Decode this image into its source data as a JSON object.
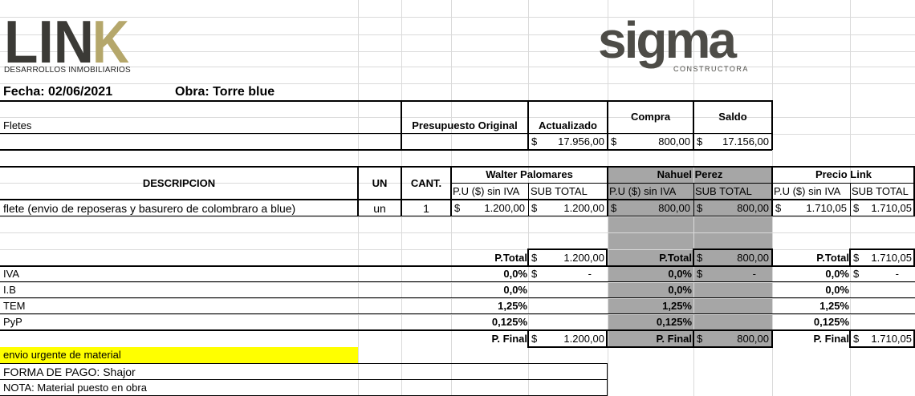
{
  "logos": {
    "link": {
      "word": "LINK",
      "subtitle": "DESARROLLOS INMOBILIARIOS"
    },
    "sigma": {
      "word": "sigma",
      "subtitle": "CONSTRUCTORA"
    }
  },
  "header": {
    "fecha": "Fecha: 02/06/2021",
    "obra": "Obra:  Torre blue"
  },
  "fletes_label": "Fletes",
  "budget": {
    "headers": {
      "original": "Presupuesto Original",
      "actualizado": "Actualizado",
      "compra": "Compra",
      "saldo": "Saldo"
    },
    "currency": "$",
    "actualizado": "17.956,00",
    "compra": "800,00",
    "saldo": "17.156,00"
  },
  "table": {
    "headers": {
      "descripcion": "DESCRIPCION",
      "un": "UN",
      "cant": "CANT.",
      "pu": "P.U ($) sin IVA",
      "subtotal": "SUB TOTAL"
    },
    "suppliers": [
      "Walter Palomares",
      "Nahuel Perez",
      "Precio Link"
    ],
    "row": {
      "descripcion": "flete (envio de reposeras y basurero de colombraro a blue)",
      "un": "un",
      "cant": "1",
      "walter_pu": "1.200,00",
      "walter_sub": "1.200,00",
      "nahuel_pu": "800,00",
      "nahuel_sub": "800,00",
      "link_pu": "1.710,05",
      "link_sub": "1.710,05"
    }
  },
  "summary": {
    "ptotal_label": "P.Total",
    "pfinal_label": "P. Final",
    "labels": [
      "IVA",
      "I.B",
      "TEM",
      "PyP"
    ],
    "rates": [
      "0,0%",
      "0,0%",
      "1,25%",
      "0,125%"
    ],
    "dash": "-",
    "walter": {
      "ptotal": "1.200,00",
      "pfinal": "1.200,00"
    },
    "nahuel": {
      "ptotal": "800,00",
      "pfinal": "800,00"
    },
    "link": {
      "ptotal": "1.710,05",
      "pfinal": "1.710,05"
    }
  },
  "notes": {
    "urgent": "envio urgente de material",
    "forma_pago": "FORMA DE PAGO: Shajor",
    "nota": "NOTA: Material puesto en obra"
  },
  "colors": {
    "link_gold": "#b5a76b",
    "link_dark": "#3b3a36",
    "sigma_gray": "#4d4c47",
    "highlight": "#ffff00",
    "shade": "#a6a6a6"
  }
}
